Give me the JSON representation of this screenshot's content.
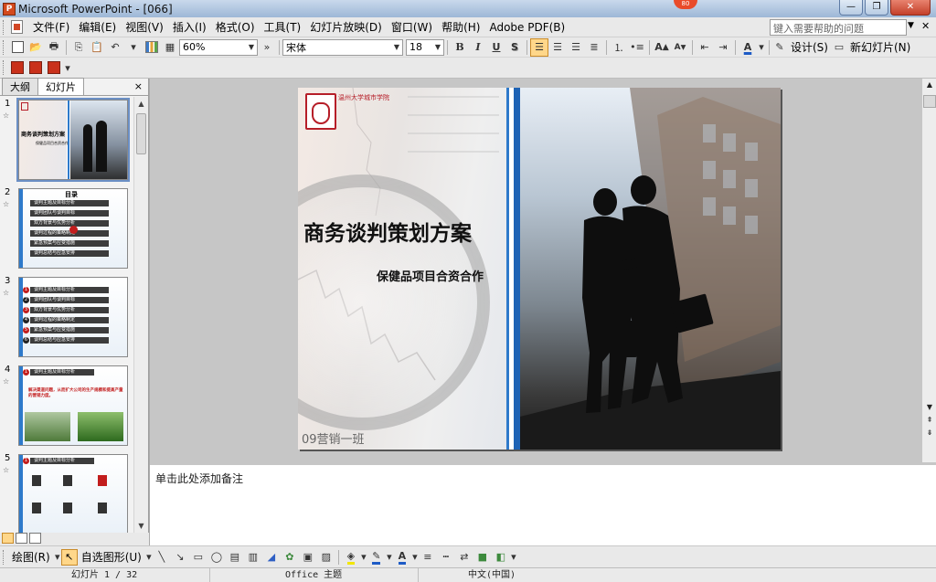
{
  "window": {
    "title": "Microsoft PowerPoint - [066]",
    "notification_badge": "80",
    "minimize_label": "—",
    "restore_label": "❐",
    "close_label": "✕"
  },
  "menubar": {
    "items": [
      "文件(F)",
      "编辑(E)",
      "视图(V)",
      "插入(I)",
      "格式(O)",
      "工具(T)",
      "幻灯片放映(D)",
      "窗口(W)",
      "帮助(H)",
      "Adobe PDF(B)"
    ],
    "help_placeholder": "键入需要帮助的问题",
    "close_label": "✕"
  },
  "toolbar": {
    "zoom": "60%",
    "font": "宋体",
    "font_size": "18",
    "bold": "B",
    "italic": "I",
    "underline": "U",
    "shadow": "S",
    "font_color_letter": "A",
    "grow_font": "A",
    "shrink_font": "A",
    "design_label": "设计(S)",
    "new_slide_label": "新幻灯片(N)"
  },
  "left_panel": {
    "tabs": [
      "大纲",
      "幻灯片"
    ],
    "active_tab": "幻灯片",
    "close_label": "×",
    "slides": [
      {
        "number": "1",
        "title": "商务谈判策划方案",
        "subtitle": "保健品项目合资合作"
      },
      {
        "number": "2",
        "title": "目录",
        "lines": [
          "谈判主题及目标分析",
          "谈判团队与谈判目标",
          "双方背景与优势分析",
          "谈判过程的策略制定",
          "紧急预案与应变措施",
          "谈判总结与应急安排"
        ]
      },
      {
        "number": "3",
        "lines": [
          "谈判主题及目标分析",
          "谈判团队与谈判目标",
          "双方背景与优势分析",
          "谈判过程的策略制定",
          "紧急预案与应变措施",
          "谈判总结与应急安排"
        ]
      },
      {
        "number": "4",
        "header": "谈判主题及目标分析",
        "body": "解决渠道问题，从而扩大公司的生产规模和提高产量的营销力度。"
      },
      {
        "number": "5",
        "header": "谈判主题及目标分析"
      }
    ]
  },
  "slide": {
    "logo_text": "温州大学城市学院",
    "title": "商务谈判策划方案",
    "subtitle": "保健品项目合资合作",
    "class_label": "09营销一班"
  },
  "notes": {
    "placeholder": "单击此处添加备注"
  },
  "drawbar": {
    "draw_label": "绘图(R)",
    "autoshape_label": "自选图形(U)"
  },
  "status": {
    "slide_position": "幻灯片 1 / 32",
    "theme": "Office 主题",
    "language": "中文(中国)"
  },
  "colors": {
    "accent_red": "#B61E28",
    "bar_blue": "#2E7ACB",
    "toolbar_bg": "#E9E9E9",
    "highlight": "#FFD78A"
  }
}
